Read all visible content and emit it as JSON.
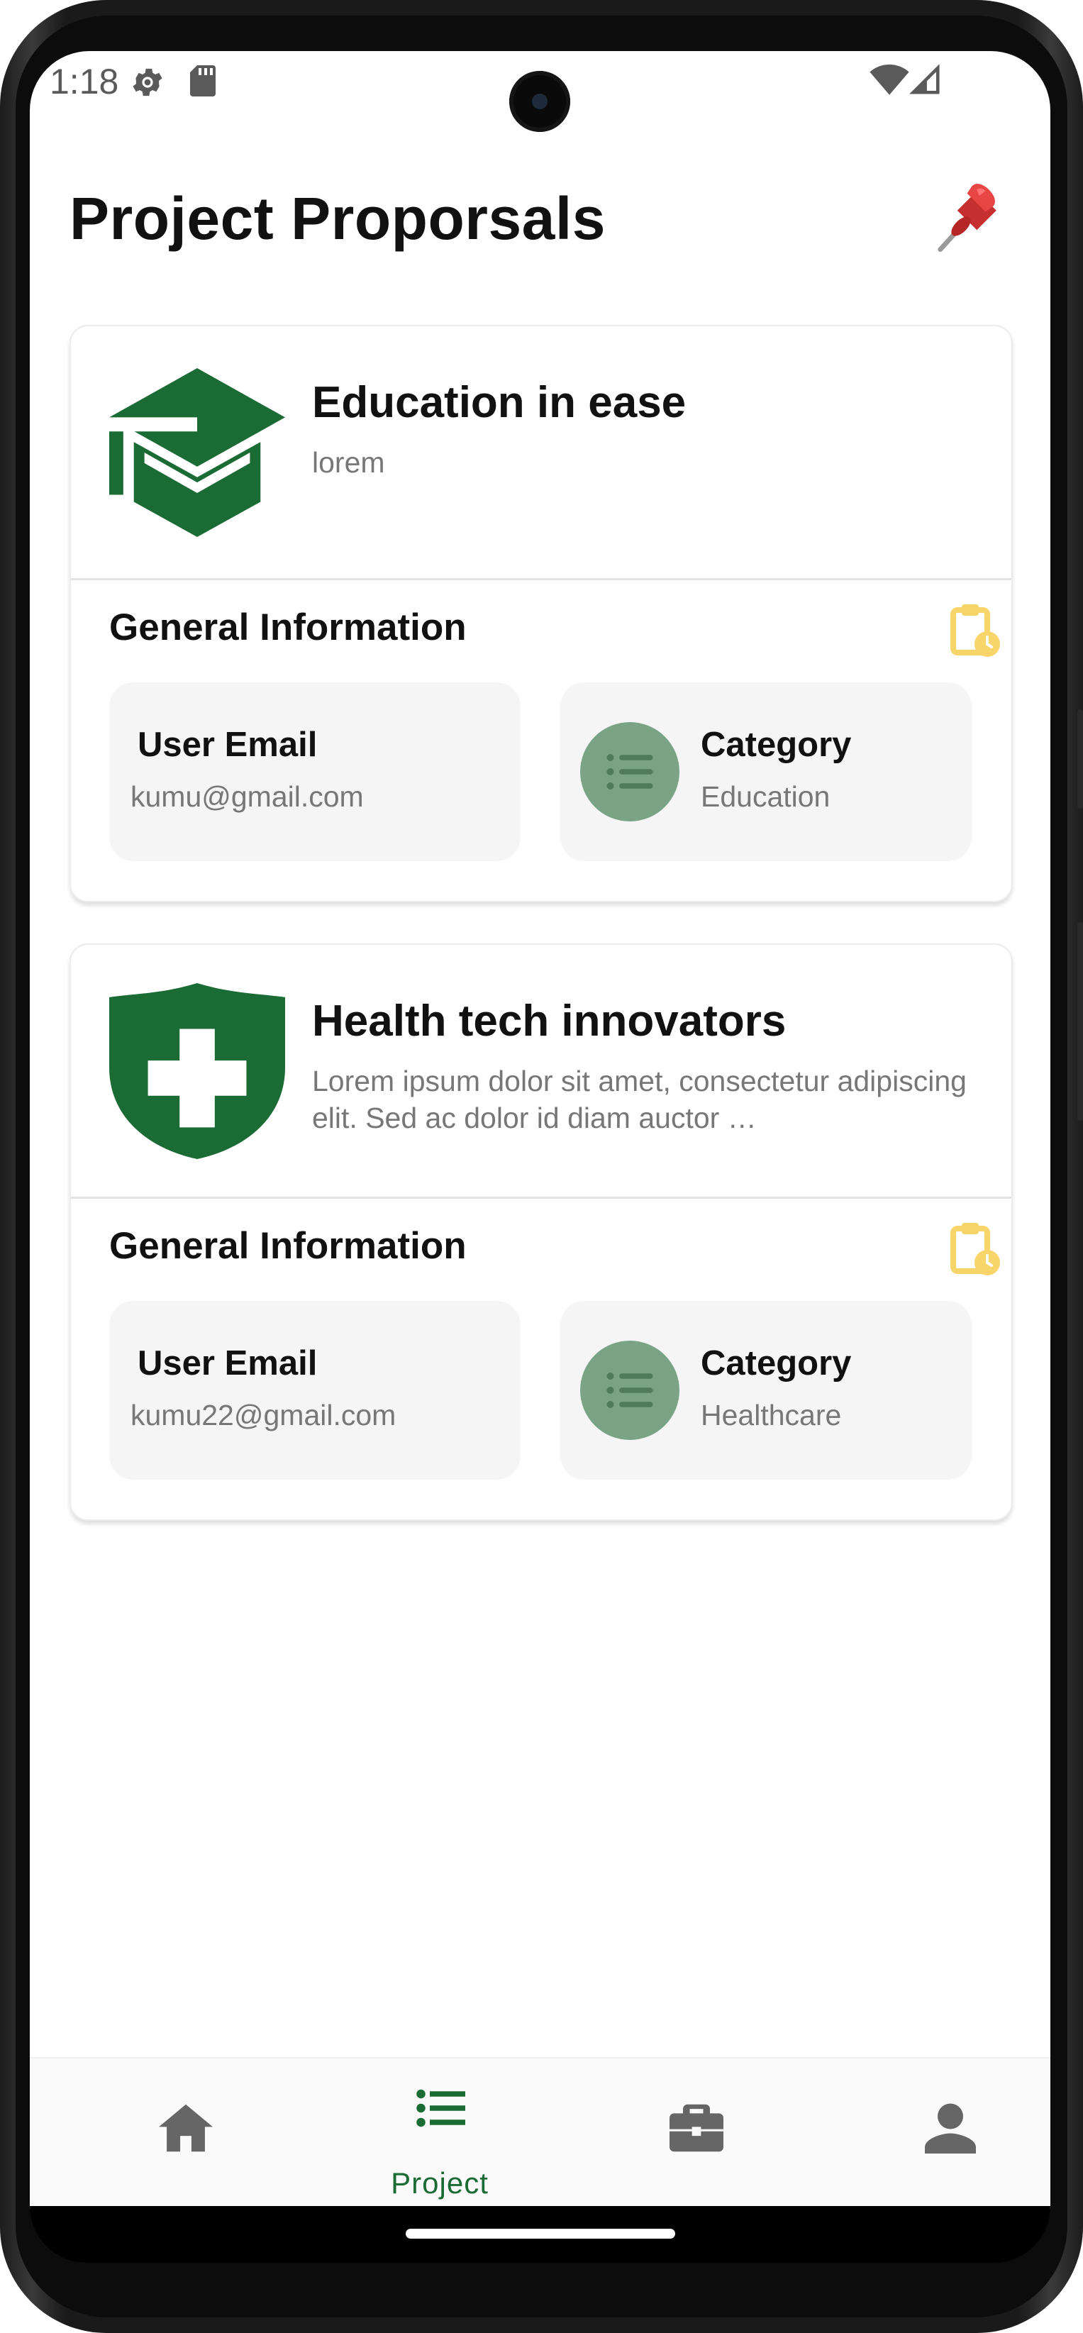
{
  "status_bar": {
    "time": "1:18"
  },
  "header": {
    "title": "Project Proporsals",
    "pin_icon": "pushpin-icon"
  },
  "colors": {
    "brand_green": "#1b6b35",
    "category_circle": "#7aa385",
    "pending_icon": "#f7d56b",
    "muted_text": "#777777"
  },
  "projects": [
    {
      "title": "Education in ease",
      "description": "lorem",
      "icon": "graduation-cap-icon",
      "section_title": "General Information",
      "email_label": "User Email",
      "email": "kumu@gmail.com",
      "category_label": "Category",
      "category": "Education"
    },
    {
      "title": "Health tech innovators",
      "description": "Lorem ipsum dolor sit amet, consectetur adipiscing elit. Sed ac dolor id diam auctor …",
      "icon": "medical-shield-icon",
      "section_title": "General Information",
      "email_label": "User Email",
      "email": "kumu22@gmail.com",
      "category_label": "Category",
      "category": "Healthcare"
    }
  ],
  "bottom_nav": {
    "items": [
      {
        "icon": "home-icon",
        "label": ""
      },
      {
        "icon": "list-icon",
        "label": "Project",
        "active": true
      },
      {
        "icon": "briefcase-icon",
        "label": ""
      },
      {
        "icon": "person-icon",
        "label": ""
      }
    ]
  }
}
